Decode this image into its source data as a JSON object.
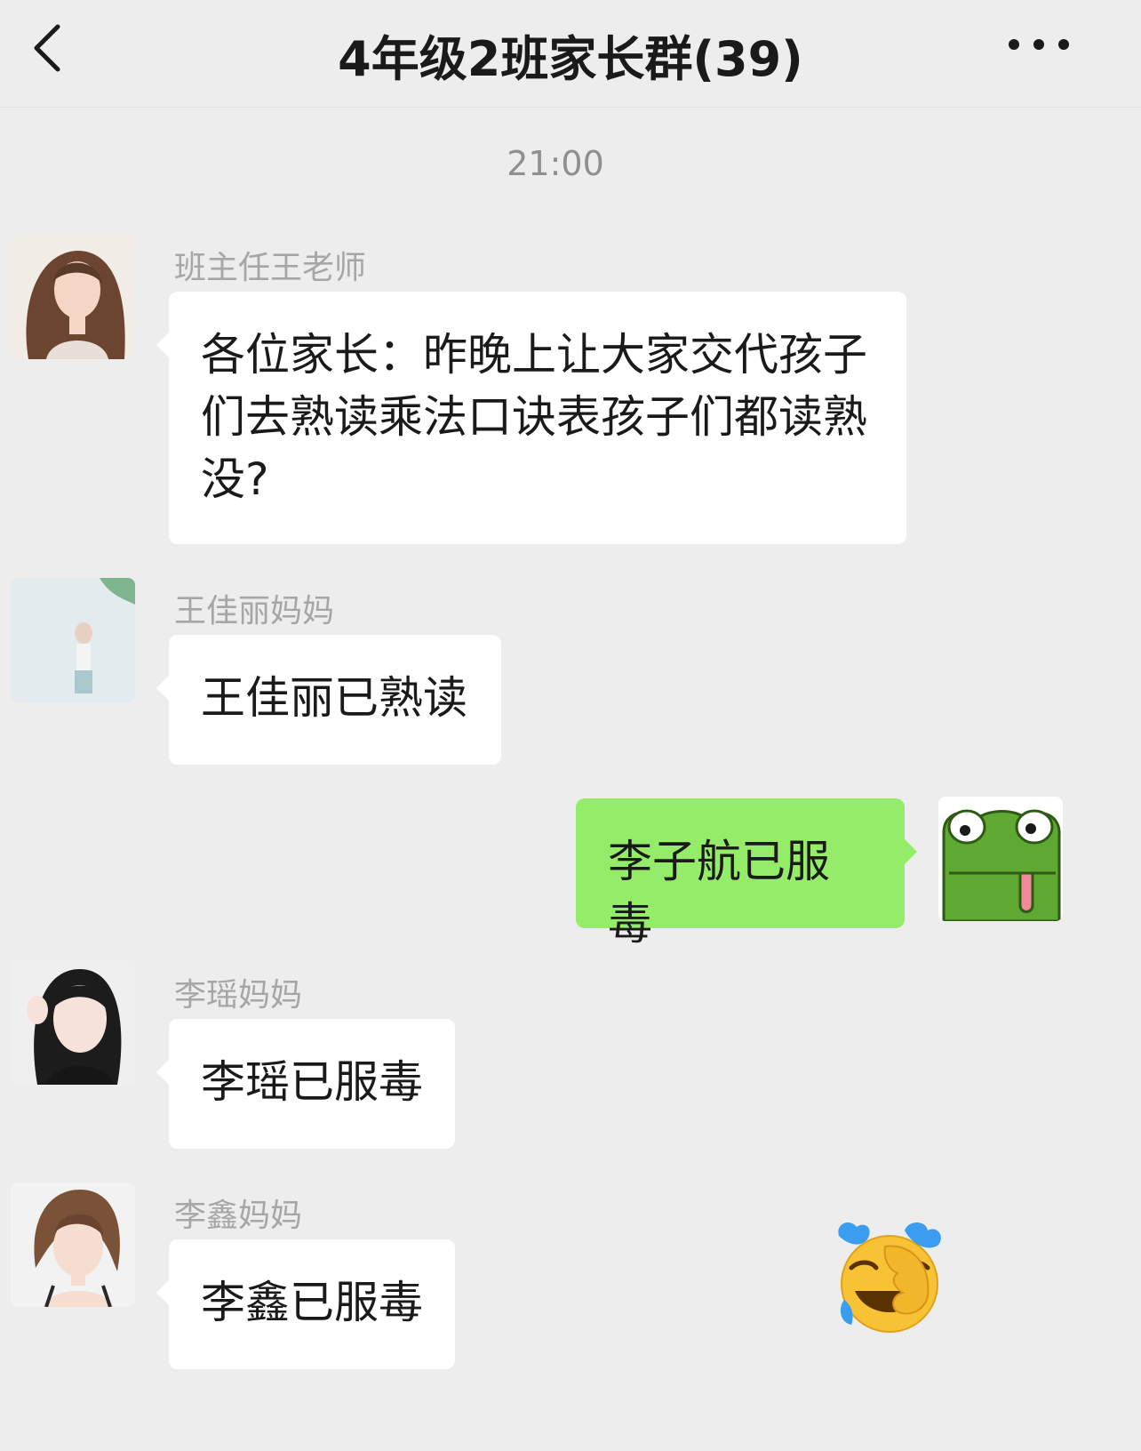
{
  "header": {
    "back_icon": "chevron-left-icon",
    "title": "4年级2班家长群(39)",
    "more_icon": "more-dots-icon"
  },
  "chat": {
    "timestamp": "21:00",
    "messages": [
      {
        "sender": "班主任王老师",
        "text": "各位家长：昨晚上让大家交代孩子们去熟读乘法口诀表孩子们都读熟没?",
        "side": "left"
      },
      {
        "sender": "王佳丽妈妈",
        "text": "王佳丽已熟读",
        "side": "left"
      },
      {
        "sender": "",
        "text": "李子航已服毒",
        "side": "right"
      },
      {
        "sender": "李瑶妈妈",
        "text": "李瑶已服毒",
        "side": "left"
      },
      {
        "sender": "李鑫妈妈",
        "text": "李鑫已服毒",
        "side": "left"
      }
    ],
    "reaction_emoji": "crying-laughing-facepalm-emoji"
  },
  "colors": {
    "background": "#ededed",
    "bubble_left": "#ffffff",
    "bubble_right": "#95ec69"
  }
}
